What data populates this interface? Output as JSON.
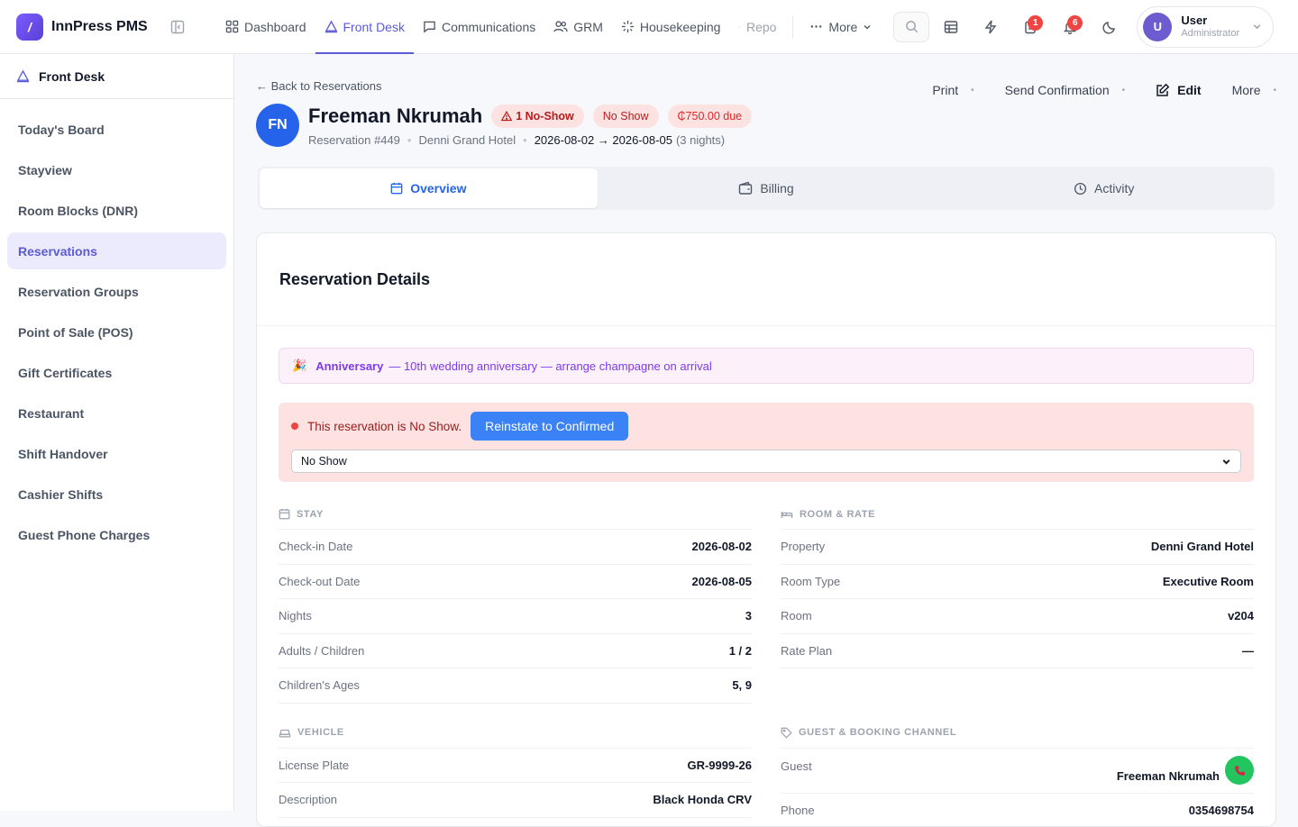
{
  "app": {
    "brand": "InnPress PMS",
    "logo_letter": "/"
  },
  "nav": {
    "items": [
      {
        "label": "Dashboard",
        "icon": "grid-icon"
      },
      {
        "label": "Front Desk",
        "icon": "front-desk-icon",
        "active": true
      },
      {
        "label": "Communications",
        "icon": "chat-icon"
      },
      {
        "label": "GRM",
        "icon": "users-icon"
      },
      {
        "label": "Housekeeping",
        "icon": "sparkle-icon"
      },
      {
        "label": "Repo",
        "icon": "bar-chart-icon"
      }
    ],
    "more_label": "More",
    "badges": {
      "tasks": "1",
      "notifications": "6"
    }
  },
  "user": {
    "initial": "U",
    "name": "User",
    "role": "Administrator"
  },
  "sidebar": {
    "section": "Front Desk",
    "items": [
      {
        "label": "Today's Board"
      },
      {
        "label": "Stayview"
      },
      {
        "label": "Room Blocks (DNR)"
      },
      {
        "label": "Reservations",
        "active": true
      },
      {
        "label": "Reservation Groups"
      },
      {
        "label": "Point of Sale (POS)"
      },
      {
        "label": "Gift Certificates"
      },
      {
        "label": "Restaurant"
      },
      {
        "label": "Shift Handover"
      },
      {
        "label": "Cashier Shifts"
      },
      {
        "label": "Guest Phone Charges"
      }
    ]
  },
  "header": {
    "back": "← Back to Reservations",
    "initials": "FN",
    "guest_name": "Freeman Nkrumah",
    "pill_noshow_count": "1 No-Show",
    "pill_status": "No Show",
    "pill_due": "₵750.00 due",
    "reservation_no": "Reservation #449",
    "property": "Denni Grand Hotel",
    "dates": "2026-08-02 → 2026-08-05",
    "nights": "(3 nights)",
    "actions": {
      "print": "Print",
      "send": "Send Confirmation",
      "edit": "Edit",
      "more": "More"
    }
  },
  "tabs": [
    {
      "label": "Overview",
      "active": true
    },
    {
      "label": "Billing"
    },
    {
      "label": "Activity"
    }
  ],
  "details": {
    "title": "Reservation Details",
    "occasion": {
      "label": "Anniversary",
      "note": "— 10th wedding anniversary — arrange champagne on arrival"
    },
    "noshow": {
      "text": "This reservation is No Show.",
      "button": "Reinstate to Confirmed",
      "select_value": "No Show"
    },
    "stay": {
      "heading": "STAY",
      "rows": [
        {
          "label": "Check-in Date",
          "value": "2026-08-02"
        },
        {
          "label": "Check-out Date",
          "value": "2026-08-05"
        },
        {
          "label": "Nights",
          "value": "3"
        },
        {
          "label": "Adults / Children",
          "value": "1 / 2"
        },
        {
          "label": "Children's Ages",
          "value": "5, 9"
        }
      ]
    },
    "room": {
      "heading": "ROOM & RATE",
      "rows": [
        {
          "label": "Property",
          "value": "Denni Grand Hotel"
        },
        {
          "label": "Room Type",
          "value": "Executive Room"
        },
        {
          "label": "Room",
          "value": "v204"
        },
        {
          "label": "Rate Plan",
          "value": "—"
        }
      ]
    },
    "vehicle": {
      "heading": "VEHICLE",
      "rows": [
        {
          "label": "License Plate",
          "value": "GR-9999-26"
        },
        {
          "label": "Description",
          "value": "Black Honda CRV"
        }
      ]
    },
    "guest": {
      "heading": "GUEST & BOOKING CHANNEL",
      "rows": [
        {
          "label": "Guest",
          "value": "Freeman Nkrumah"
        },
        {
          "label": "Phone",
          "value": "0354698754"
        }
      ]
    }
  }
}
